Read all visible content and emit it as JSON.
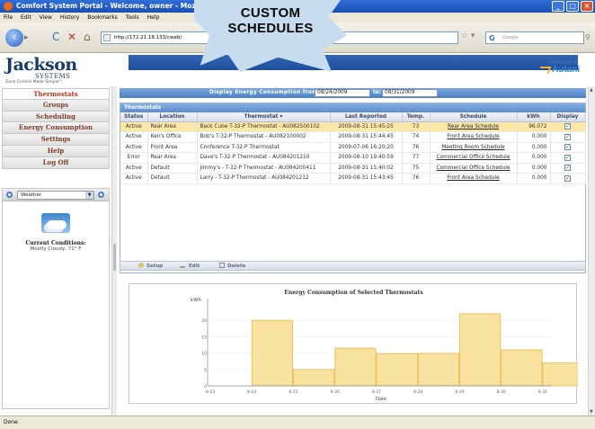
{
  "window": {
    "title": "Comfort System Portal - Welcome, owner - Mozilla Fi"
  },
  "menu": [
    "File",
    "Edit",
    "View",
    "History",
    "Bookmarks",
    "Tools",
    "Help"
  ],
  "toolbar": {
    "url": "http://172.21.18.133/cweb/",
    "search_placeholder": "Google"
  },
  "callout": {
    "line1": "CUSTOM",
    "line2": "SCHEDULES"
  },
  "header": {
    "brand": "Jackson",
    "brand_sub": "SYSTEMS",
    "tagline": "Zone Control Made Simple™",
    "powered_by": "POWERED BY",
    "partner": "Autani"
  },
  "sidebar": {
    "items": [
      {
        "label": "Thermostats",
        "active": true
      },
      {
        "label": "Groups",
        "active": false
      },
      {
        "label": "Scheduling",
        "active": false
      },
      {
        "label": "Energy Consumption",
        "active": false
      },
      {
        "label": "Settings",
        "active": false
      },
      {
        "label": "Help",
        "active": false
      },
      {
        "label": "Log Off",
        "active": false
      }
    ],
    "weather": {
      "selected": "Weather",
      "conditions_title": "Current Conditions:",
      "conditions_detail": "Mostly Cloudy, 71° F"
    }
  },
  "energy": {
    "label": "Display Energy Consumption from:",
    "from": "08/24/2009",
    "to_label": "to:",
    "to": "08/31/2009"
  },
  "grid": {
    "title": "Thermostats",
    "columns": [
      "Status",
      "Location",
      "Thermostat ▾",
      "Last Reported",
      "Temp.",
      "Schedule",
      "kWh",
      "Display"
    ],
    "rows": [
      {
        "status": "Active",
        "location": "Rear Area",
        "thermostat": "Back Cube T-32-P Thermostat - AU082500102",
        "reported": "2009-08-31 15:45:25",
        "temp": "73",
        "schedule": "Rear Area Schedule",
        "kwh": "96.072",
        "display": true,
        "selected": true
      },
      {
        "status": "Active",
        "location": "Ken's Office",
        "thermostat": "Bob's T-32-P Thermostat - AU082100002",
        "reported": "2009-08-31 15:44:45",
        "temp": "74",
        "schedule": "Front Area Schedule",
        "kwh": "0.000",
        "display": true,
        "selected": false
      },
      {
        "status": "Active",
        "location": "Front Area",
        "thermostat": "Conference T-32-P Thermostat",
        "reported": "2009-07-06 16:20:20",
        "temp": "76",
        "schedule": "Meeting Room Schedule",
        "kwh": "0.000",
        "display": true,
        "selected": false
      },
      {
        "status": "Error",
        "location": "Rear Area",
        "thermostat": "Dave's T-32-P Thermostat - AU084201210",
        "reported": "2009-08-10 19:40:59",
        "temp": "77",
        "schedule": "Commercial Office Schedule",
        "kwh": "0.000",
        "display": true,
        "selected": false
      },
      {
        "status": "Active",
        "location": "Default",
        "thermostat": "Jimmy's - T-32-P Thermostat - AU084200411",
        "reported": "2009-08-31 15:40:02",
        "temp": "75",
        "schedule": "Commercial Office Schedule",
        "kwh": "0.000",
        "display": true,
        "selected": false
      },
      {
        "status": "Active",
        "location": "Default",
        "thermostat": "Larry - T-32-P Thermostat - AU084201212",
        "reported": "2009-08-31 15:43:45",
        "temp": "76",
        "schedule": "Front Area Schedule",
        "kwh": "0.000",
        "display": true,
        "selected": false
      }
    ],
    "actions": {
      "setup": "Setup",
      "edit": "Edit",
      "delete": "Delete"
    }
  },
  "chart_data": {
    "type": "bar",
    "title": "Energy Consumption of Selected Thermostats",
    "ylabel": "kWh",
    "xlabel": "Date",
    "ylim": [
      0,
      25
    ],
    "yticks": [
      0,
      5,
      10,
      15,
      20
    ],
    "categories": [
      "8-23",
      "8-24",
      "8-25",
      "8-26",
      "8-27",
      "8-28",
      "8-29",
      "8-30",
      "8-31"
    ],
    "values": [
      0,
      20,
      5,
      11.5,
      9.8,
      9.9,
      22,
      11,
      7
    ],
    "bar_color": "#f8e2a0",
    "bar_edge": "#e6b94a"
  },
  "status": {
    "text": "Done"
  }
}
